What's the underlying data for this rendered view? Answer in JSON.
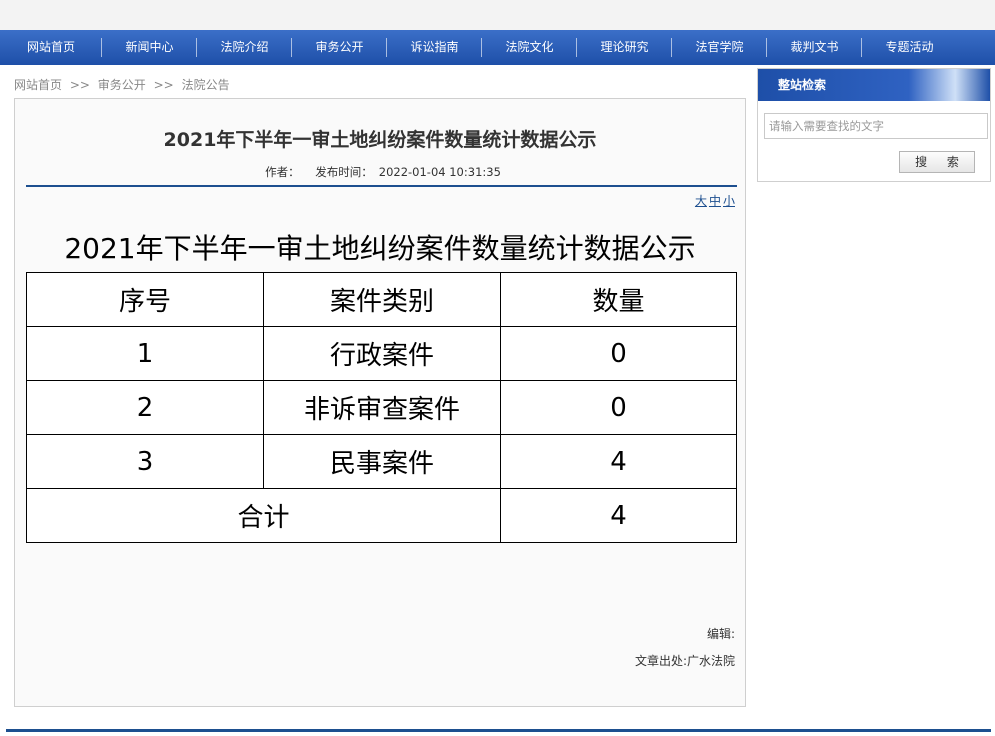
{
  "nav": {
    "items": [
      "网站首页",
      "新闻中心",
      "法院介绍",
      "审务公开",
      "诉讼指南",
      "法院文化",
      "理论研究",
      "法官学院",
      "裁判文书",
      "专题活动"
    ]
  },
  "breadcrumb": [
    "网站首页",
    "审务公开",
    "法院公告"
  ],
  "breadcrumb_sep": ">>",
  "article": {
    "title": "2021年下半年一审土地纠纷案件数量统计数据公示",
    "author_label": "作者：",
    "publish_label": "发布时间：",
    "publish_time": "2022-01-04 10:31:35",
    "font_sizes": [
      "大",
      "中",
      "小"
    ],
    "content_title": "2021年下半年一审土地纠纷案件数量统计数据公示",
    "table": {
      "headers": [
        "序号",
        "案件类别",
        "数量"
      ],
      "rows": [
        [
          "1",
          "行政案件",
          "0"
        ],
        [
          "2",
          "非诉审查案件",
          "0"
        ],
        [
          "3",
          "民事案件",
          "4"
        ]
      ],
      "total_label": "合计",
      "total_value": "4"
    },
    "editor_label": "编辑:",
    "source_label": "文章出处:",
    "source_value": "广水法院"
  },
  "sidebar": {
    "heading": "整站检索",
    "search_placeholder": "请输入需要查找的文字",
    "search_button": "搜 索"
  }
}
